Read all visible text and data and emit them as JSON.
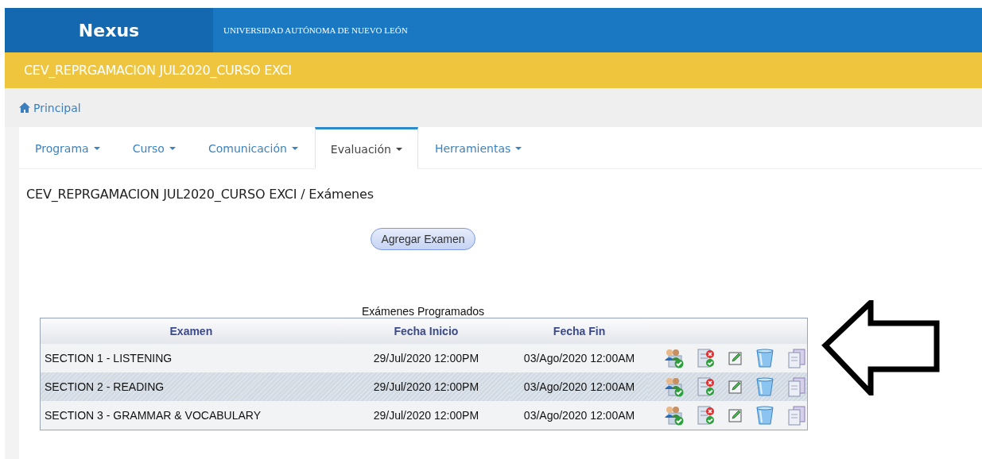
{
  "header": {
    "brand": "Nexus",
    "institution": "UNIVERSIDAD AUTÓNOMA DE NUEVO LEÓN"
  },
  "course_bar": {
    "title": "CEV_REPRGAMACION JUL2020_CURSO EXCI"
  },
  "breadcrumb": {
    "label": "Principal"
  },
  "tabs": [
    {
      "label": "Programa",
      "selected": false
    },
    {
      "label": "Curso",
      "selected": false
    },
    {
      "label": "Comunicación",
      "selected": false
    },
    {
      "label": "Evaluación",
      "selected": true
    },
    {
      "label": "Herramientas",
      "selected": false
    }
  ],
  "page_title": "CEV_REPRGAMACION JUL2020_CURSO EXCI / Exámenes",
  "add_button": "Agregar Examen",
  "table": {
    "caption": "Exámenes Programados",
    "columns": [
      "Examen",
      "Fecha Inicio",
      "Fecha Fin"
    ],
    "rows": [
      {
        "exam": "SECTION 1 - LISTENING",
        "start": "29/Jul/2020 12:00PM",
        "end": "03/Ago/2020 12:00AM",
        "selected": false
      },
      {
        "exam": "SECTION 2 - READING",
        "start": "29/Jul/2020 12:00PM",
        "end": "03/Ago/2020 12:00AM",
        "selected": true
      },
      {
        "exam": "SECTION 3 - GRAMMAR & VOCABULARY",
        "start": "29/Jul/2020 12:00PM",
        "end": "03/Ago/2020 12:00AM",
        "selected": false
      }
    ]
  }
}
